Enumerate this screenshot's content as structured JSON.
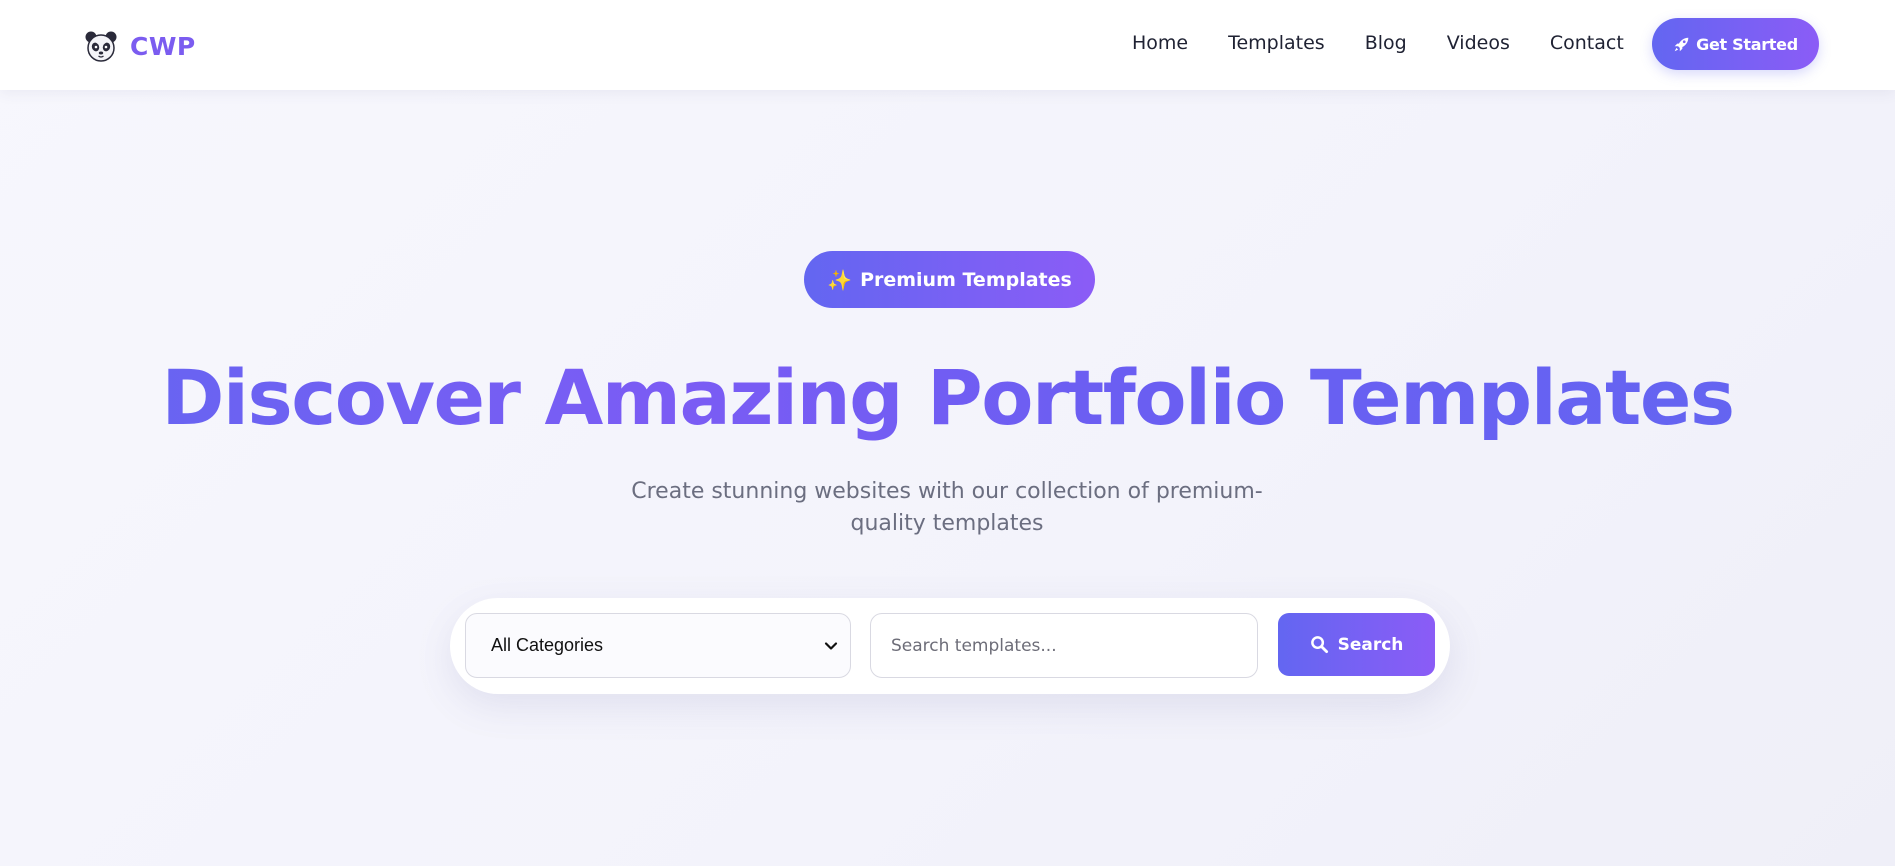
{
  "brand": {
    "name": "CWP",
    "logo_icon": "panda-icon"
  },
  "nav": {
    "items": [
      {
        "label": "Home"
      },
      {
        "label": "Templates"
      },
      {
        "label": "Blog"
      },
      {
        "label": "Videos"
      },
      {
        "label": "Contact"
      }
    ],
    "cta": {
      "label": "Get Started",
      "icon": "rocket-icon"
    }
  },
  "hero": {
    "badge": {
      "icon": "✨",
      "label": "Premium Templates"
    },
    "title": "Discover Amazing Portfolio Templates",
    "subtitle": "Create stunning websites with our collection of premium-quality templates"
  },
  "search": {
    "category": {
      "selected": "All Categories"
    },
    "input": {
      "placeholder": "Search templates...",
      "value": ""
    },
    "button": {
      "label": "Search",
      "icon": "search-icon"
    }
  },
  "colors": {
    "accent_start": "#6366f1",
    "accent_end": "#8b5cf6",
    "brand_text": "#7b5cf0",
    "subtitle_text": "#6b6e80"
  }
}
